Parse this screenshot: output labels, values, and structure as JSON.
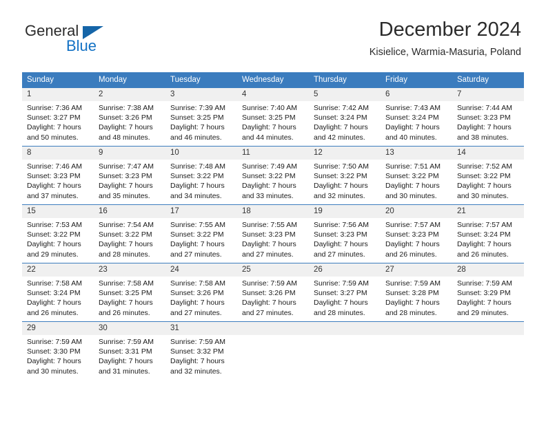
{
  "brand": {
    "name_part1": "General",
    "name_part2": "Blue",
    "accent_color": "#1271c4",
    "triangle_color": "#1565a8"
  },
  "header": {
    "title": "December 2024",
    "location": "Kisielice, Warmia-Masuria, Poland"
  },
  "theme": {
    "header_blue": "#3b7cbe",
    "daynum_bg": "#f0f0f0"
  },
  "weekdays": [
    "Sunday",
    "Monday",
    "Tuesday",
    "Wednesday",
    "Thursday",
    "Friday",
    "Saturday"
  ],
  "weeks": [
    [
      {
        "day": "1",
        "sunrise": "Sunrise: 7:36 AM",
        "sunset": "Sunset: 3:27 PM",
        "daylight1": "Daylight: 7 hours",
        "daylight2": "and 50 minutes."
      },
      {
        "day": "2",
        "sunrise": "Sunrise: 7:38 AM",
        "sunset": "Sunset: 3:26 PM",
        "daylight1": "Daylight: 7 hours",
        "daylight2": "and 48 minutes."
      },
      {
        "day": "3",
        "sunrise": "Sunrise: 7:39 AM",
        "sunset": "Sunset: 3:25 PM",
        "daylight1": "Daylight: 7 hours",
        "daylight2": "and 46 minutes."
      },
      {
        "day": "4",
        "sunrise": "Sunrise: 7:40 AM",
        "sunset": "Sunset: 3:25 PM",
        "daylight1": "Daylight: 7 hours",
        "daylight2": "and 44 minutes."
      },
      {
        "day": "5",
        "sunrise": "Sunrise: 7:42 AM",
        "sunset": "Sunset: 3:24 PM",
        "daylight1": "Daylight: 7 hours",
        "daylight2": "and 42 minutes."
      },
      {
        "day": "6",
        "sunrise": "Sunrise: 7:43 AM",
        "sunset": "Sunset: 3:24 PM",
        "daylight1": "Daylight: 7 hours",
        "daylight2": "and 40 minutes."
      },
      {
        "day": "7",
        "sunrise": "Sunrise: 7:44 AM",
        "sunset": "Sunset: 3:23 PM",
        "daylight1": "Daylight: 7 hours",
        "daylight2": "and 38 minutes."
      }
    ],
    [
      {
        "day": "8",
        "sunrise": "Sunrise: 7:46 AM",
        "sunset": "Sunset: 3:23 PM",
        "daylight1": "Daylight: 7 hours",
        "daylight2": "and 37 minutes."
      },
      {
        "day": "9",
        "sunrise": "Sunrise: 7:47 AM",
        "sunset": "Sunset: 3:23 PM",
        "daylight1": "Daylight: 7 hours",
        "daylight2": "and 35 minutes."
      },
      {
        "day": "10",
        "sunrise": "Sunrise: 7:48 AM",
        "sunset": "Sunset: 3:22 PM",
        "daylight1": "Daylight: 7 hours",
        "daylight2": "and 34 minutes."
      },
      {
        "day": "11",
        "sunrise": "Sunrise: 7:49 AM",
        "sunset": "Sunset: 3:22 PM",
        "daylight1": "Daylight: 7 hours",
        "daylight2": "and 33 minutes."
      },
      {
        "day": "12",
        "sunrise": "Sunrise: 7:50 AM",
        "sunset": "Sunset: 3:22 PM",
        "daylight1": "Daylight: 7 hours",
        "daylight2": "and 32 minutes."
      },
      {
        "day": "13",
        "sunrise": "Sunrise: 7:51 AM",
        "sunset": "Sunset: 3:22 PM",
        "daylight1": "Daylight: 7 hours",
        "daylight2": "and 30 minutes."
      },
      {
        "day": "14",
        "sunrise": "Sunrise: 7:52 AM",
        "sunset": "Sunset: 3:22 PM",
        "daylight1": "Daylight: 7 hours",
        "daylight2": "and 30 minutes."
      }
    ],
    [
      {
        "day": "15",
        "sunrise": "Sunrise: 7:53 AM",
        "sunset": "Sunset: 3:22 PM",
        "daylight1": "Daylight: 7 hours",
        "daylight2": "and 29 minutes."
      },
      {
        "day": "16",
        "sunrise": "Sunrise: 7:54 AM",
        "sunset": "Sunset: 3:22 PM",
        "daylight1": "Daylight: 7 hours",
        "daylight2": "and 28 minutes."
      },
      {
        "day": "17",
        "sunrise": "Sunrise: 7:55 AM",
        "sunset": "Sunset: 3:22 PM",
        "daylight1": "Daylight: 7 hours",
        "daylight2": "and 27 minutes."
      },
      {
        "day": "18",
        "sunrise": "Sunrise: 7:55 AM",
        "sunset": "Sunset: 3:23 PM",
        "daylight1": "Daylight: 7 hours",
        "daylight2": "and 27 minutes."
      },
      {
        "day": "19",
        "sunrise": "Sunrise: 7:56 AM",
        "sunset": "Sunset: 3:23 PM",
        "daylight1": "Daylight: 7 hours",
        "daylight2": "and 27 minutes."
      },
      {
        "day": "20",
        "sunrise": "Sunrise: 7:57 AM",
        "sunset": "Sunset: 3:23 PM",
        "daylight1": "Daylight: 7 hours",
        "daylight2": "and 26 minutes."
      },
      {
        "day": "21",
        "sunrise": "Sunrise: 7:57 AM",
        "sunset": "Sunset: 3:24 PM",
        "daylight1": "Daylight: 7 hours",
        "daylight2": "and 26 minutes."
      }
    ],
    [
      {
        "day": "22",
        "sunrise": "Sunrise: 7:58 AM",
        "sunset": "Sunset: 3:24 PM",
        "daylight1": "Daylight: 7 hours",
        "daylight2": "and 26 minutes."
      },
      {
        "day": "23",
        "sunrise": "Sunrise: 7:58 AM",
        "sunset": "Sunset: 3:25 PM",
        "daylight1": "Daylight: 7 hours",
        "daylight2": "and 26 minutes."
      },
      {
        "day": "24",
        "sunrise": "Sunrise: 7:58 AM",
        "sunset": "Sunset: 3:26 PM",
        "daylight1": "Daylight: 7 hours",
        "daylight2": "and 27 minutes."
      },
      {
        "day": "25",
        "sunrise": "Sunrise: 7:59 AM",
        "sunset": "Sunset: 3:26 PM",
        "daylight1": "Daylight: 7 hours",
        "daylight2": "and 27 minutes."
      },
      {
        "day": "26",
        "sunrise": "Sunrise: 7:59 AM",
        "sunset": "Sunset: 3:27 PM",
        "daylight1": "Daylight: 7 hours",
        "daylight2": "and 28 minutes."
      },
      {
        "day": "27",
        "sunrise": "Sunrise: 7:59 AM",
        "sunset": "Sunset: 3:28 PM",
        "daylight1": "Daylight: 7 hours",
        "daylight2": "and 28 minutes."
      },
      {
        "day": "28",
        "sunrise": "Sunrise: 7:59 AM",
        "sunset": "Sunset: 3:29 PM",
        "daylight1": "Daylight: 7 hours",
        "daylight2": "and 29 minutes."
      }
    ],
    [
      {
        "day": "29",
        "sunrise": "Sunrise: 7:59 AM",
        "sunset": "Sunset: 3:30 PM",
        "daylight1": "Daylight: 7 hours",
        "daylight2": "and 30 minutes."
      },
      {
        "day": "30",
        "sunrise": "Sunrise: 7:59 AM",
        "sunset": "Sunset: 3:31 PM",
        "daylight1": "Daylight: 7 hours",
        "daylight2": "and 31 minutes."
      },
      {
        "day": "31",
        "sunrise": "Sunrise: 7:59 AM",
        "sunset": "Sunset: 3:32 PM",
        "daylight1": "Daylight: 7 hours",
        "daylight2": "and 32 minutes."
      },
      {
        "day": "",
        "sunrise": "",
        "sunset": "",
        "daylight1": "",
        "daylight2": ""
      },
      {
        "day": "",
        "sunrise": "",
        "sunset": "",
        "daylight1": "",
        "daylight2": ""
      },
      {
        "day": "",
        "sunrise": "",
        "sunset": "",
        "daylight1": "",
        "daylight2": ""
      },
      {
        "day": "",
        "sunrise": "",
        "sunset": "",
        "daylight1": "",
        "daylight2": ""
      }
    ]
  ]
}
